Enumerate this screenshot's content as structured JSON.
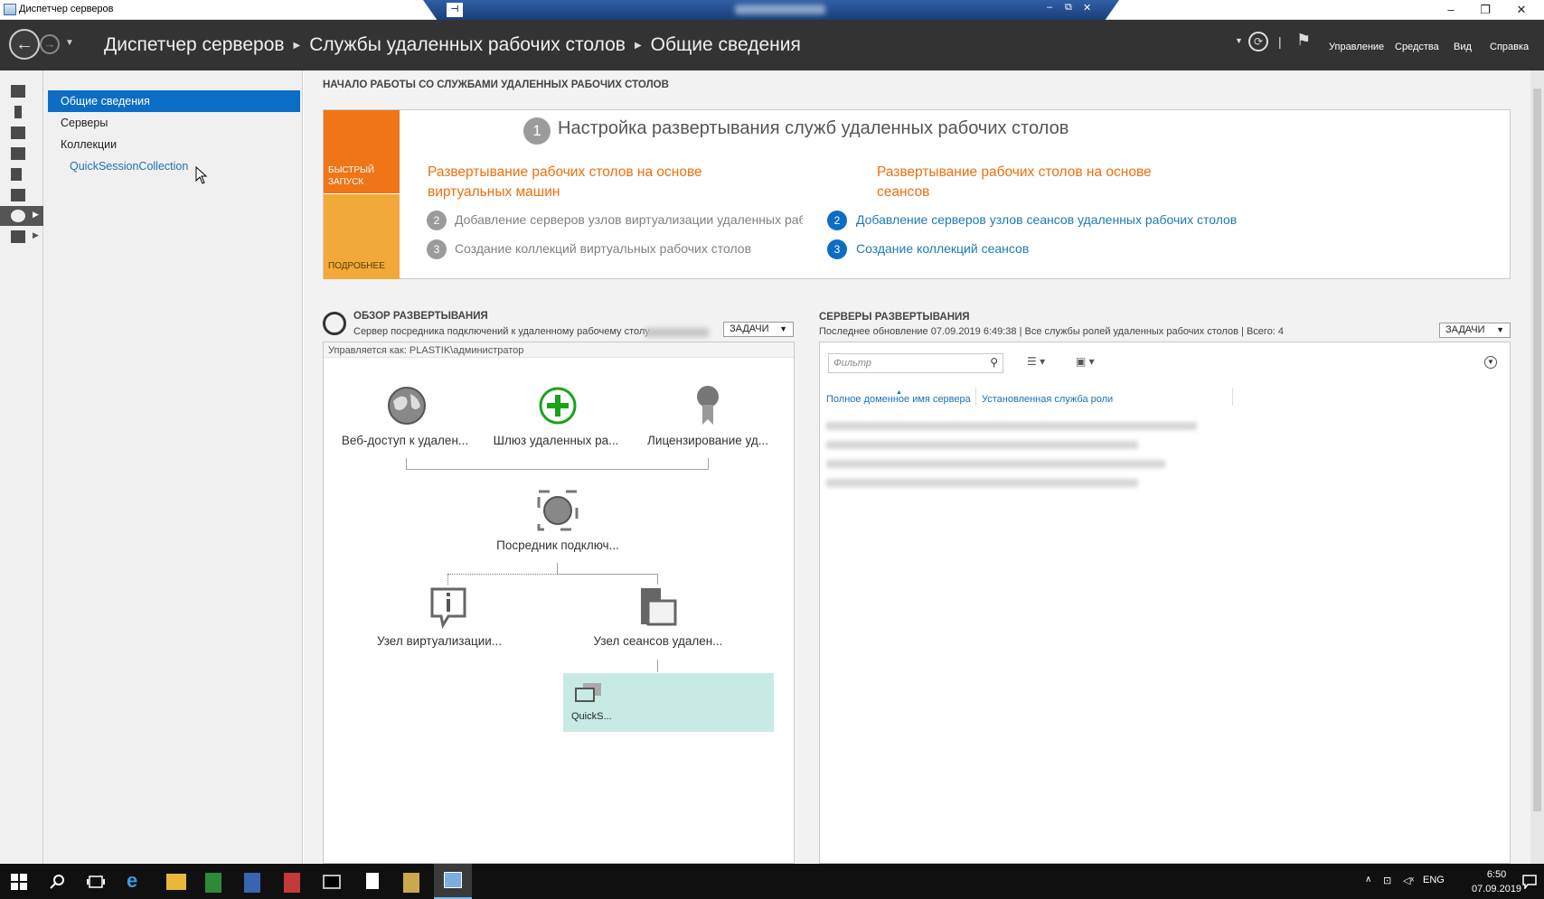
{
  "window": {
    "title": "Диспетчер серверов",
    "controls": {
      "minimize": "–",
      "maximize": "❐",
      "close": "✕"
    }
  },
  "rdp_bar": {
    "pin": "⊣",
    "ctrl_min": "–",
    "ctrl_restore": "⧉",
    "ctrl_close": "✕"
  },
  "header": {
    "breadcrumb": [
      "Диспетчер серверов",
      "Службы удаленных рабочих столов",
      "Общие сведения"
    ],
    "menu": [
      "Управление",
      "Средства",
      "Вид",
      "Справка"
    ]
  },
  "nav": {
    "items": [
      {
        "label": "Общие сведения",
        "selected": true
      },
      {
        "label": "Серверы",
        "selected": false
      },
      {
        "label": "Коллекции",
        "selected": false
      },
      {
        "label": "QuickSessionCollection",
        "selected": false
      }
    ]
  },
  "quickstart": {
    "section_title": "НАЧАЛО РАБОТЫ СО СЛУЖБАМИ УДАЛЕННЫХ РАБОЧИХ СТОЛОВ",
    "tab_quick": "БЫСТРЫЙ ЗАПУСК",
    "tab_more": "ПОДРОБНЕЕ",
    "step1_num": "1",
    "step1_title": "Настройка развертывания служб удаленных рабочих столов",
    "vm_heading": "Развертывание рабочих столов на основе виртуальных машин",
    "vm_steps": [
      {
        "num": "2",
        "label": "Добавление серверов узлов виртуализации удаленных раб"
      },
      {
        "num": "3",
        "label": "Создание коллекций виртуальных рабочих столов"
      }
    ],
    "session_heading": "Развертывание рабочих столов на основе сеансов",
    "session_steps": [
      {
        "num": "2",
        "label": "Добавление серверов узлов сеансов удаленных рабочих столов"
      },
      {
        "num": "3",
        "label": "Создание коллекций сеансов"
      }
    ]
  },
  "overview": {
    "title": "ОБЗОР РАЗВЕРТЫВАНИЯ",
    "subtitle": "Сервер посредника подключений к удаленному рабочему столу",
    "tasks": "ЗАДАЧИ",
    "managed_as": "Управляется как: PLASTIK\\администратор",
    "nodes": {
      "web": "Веб-доступ к удален...",
      "gateway": "Шлюз удаленных ра...",
      "licensing": "Лицензирование уд...",
      "broker": "Посредник подключ...",
      "virtualization": "Узел виртуализации...",
      "session_host": "Узел сеансов удален..."
    },
    "collection_tile": "QuickS..."
  },
  "servers": {
    "title": "СЕРВЕРЫ РАЗВЕРТЫВАНИЯ",
    "subtitle": "Последнее обновление 07.09.2019 6:49:38 | Все службы ролей удаленных рабочих столов  | Всего: 4",
    "tasks": "ЗАДАЧИ",
    "filter_placeholder": "Фильтр",
    "columns": [
      "Полное доменное имя сервера",
      "Установленная служба роли"
    ]
  },
  "taskbar": {
    "lang": "ENG",
    "time": "6:50",
    "date": "07.09.2019"
  },
  "colors": {
    "accent_blue": "#0b6ec4",
    "orange": "#ef7516",
    "orange_light": "#f3a83a",
    "header_bg": "#333333",
    "collection_tile": "#c7ebe4",
    "gateway_green": "#1aa31a"
  }
}
